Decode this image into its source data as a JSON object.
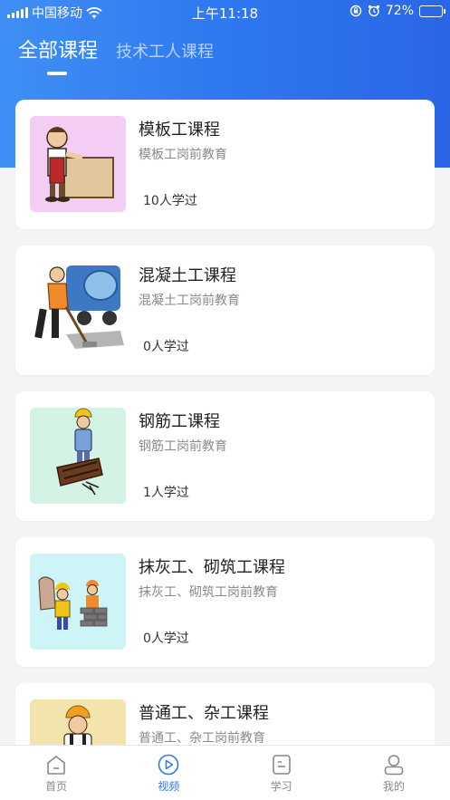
{
  "status_bar": {
    "carrier": "中国移动",
    "time": "上午11:18",
    "battery": "72%",
    "battery_level": 0.72
  },
  "tabs": [
    {
      "label": "全部课程",
      "active": true
    },
    {
      "label": "技术工人课程",
      "active": false
    }
  ],
  "courses": [
    {
      "title": "模板工课程",
      "subtitle": "模板工岗前教育",
      "learners": "10人学过",
      "thumb_bg": "#f3cdf3",
      "icon": "formwork-worker-icon"
    },
    {
      "title": "混凝土工课程",
      "subtitle": "混凝土工岗前教育",
      "learners": "0人学过",
      "thumb_bg": "#ffffff",
      "icon": "concrete-worker-icon"
    },
    {
      "title": "钢筋工课程",
      "subtitle": "钢筋工岗前教育",
      "learners": "1人学过",
      "thumb_bg": "#d3f3e4",
      "icon": "rebar-worker-icon"
    },
    {
      "title": "抹灰工、砌筑工课程",
      "subtitle": "抹灰工、砌筑工岗前教育",
      "learners": "0人学过",
      "thumb_bg": "#cdf5f7",
      "icon": "plaster-mason-icon"
    },
    {
      "title": "普通工、杂工课程",
      "subtitle": "普通工、杂工岗前教育",
      "learners": "",
      "thumb_bg": "#f3e3ad",
      "icon": "general-worker-icon"
    }
  ],
  "bottom_nav": [
    {
      "label": "首页",
      "icon": "home-icon",
      "active": false
    },
    {
      "label": "视频",
      "icon": "video-icon",
      "active": true
    },
    {
      "label": "学习",
      "icon": "study-icon",
      "active": false
    },
    {
      "label": "我的",
      "icon": "profile-icon",
      "active": false
    }
  ],
  "colors": {
    "accent": "#2f78f0",
    "header_start": "#3f8ff5",
    "header_end": "#2a66e6"
  }
}
